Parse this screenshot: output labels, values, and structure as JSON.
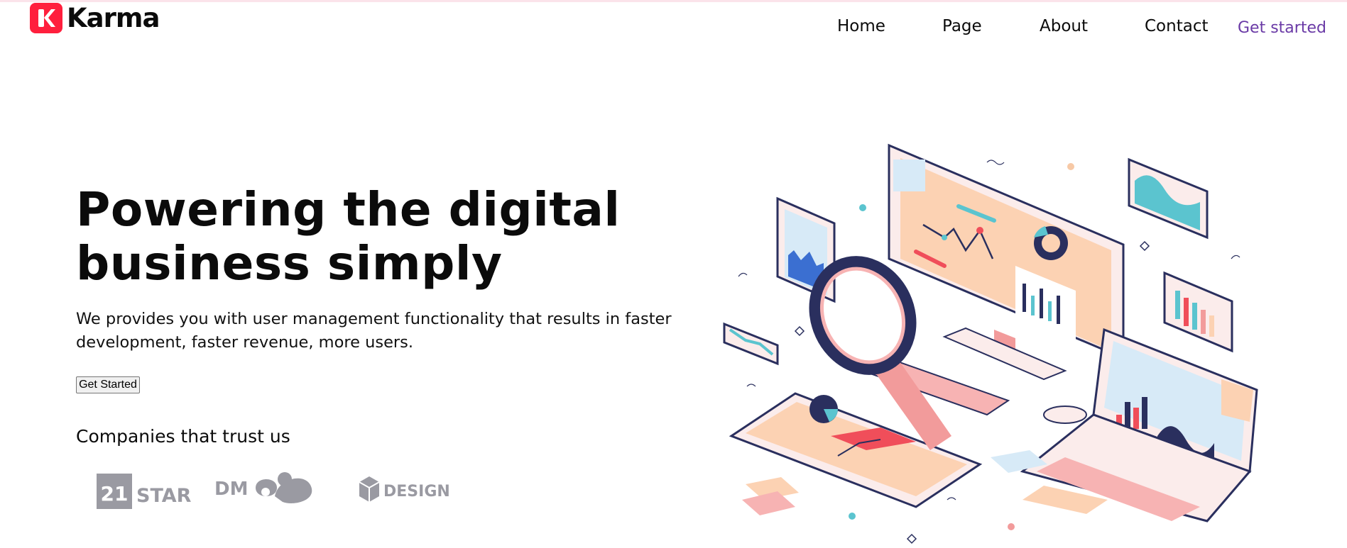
{
  "brand": {
    "name": "Karma",
    "logo_icon": "karma-k-logo-icon",
    "logo_color": "#ff1f3d"
  },
  "nav": {
    "items": [
      {
        "label": "Home"
      },
      {
        "label": "Page"
      },
      {
        "label": "About"
      },
      {
        "label": "Contact"
      }
    ],
    "cta_label": "Get started",
    "cta_color": "#6a3aa6"
  },
  "hero": {
    "title_line1": "Powering the digital",
    "title_line2": "business simply",
    "subtitle": "We provides you with user management functionality that results in faster development, faster revenue, more users.",
    "button_label": "Get Started"
  },
  "companies": {
    "heading": "Companies that trust us",
    "logos": [
      {
        "name": "21 STAR",
        "badge": "21",
        "text": "STAR",
        "icon": "21star-logo-icon"
      },
      {
        "name": "DM",
        "text": "DM",
        "icon": "dm-logo-icon"
      },
      {
        "name": "DESIGN",
        "text": "DESIGN",
        "icon": "design-cube-logo-icon"
      }
    ],
    "logo_color": "#9a9aa2"
  },
  "illustration": {
    "icon": "analytics-isometric-illustration"
  }
}
